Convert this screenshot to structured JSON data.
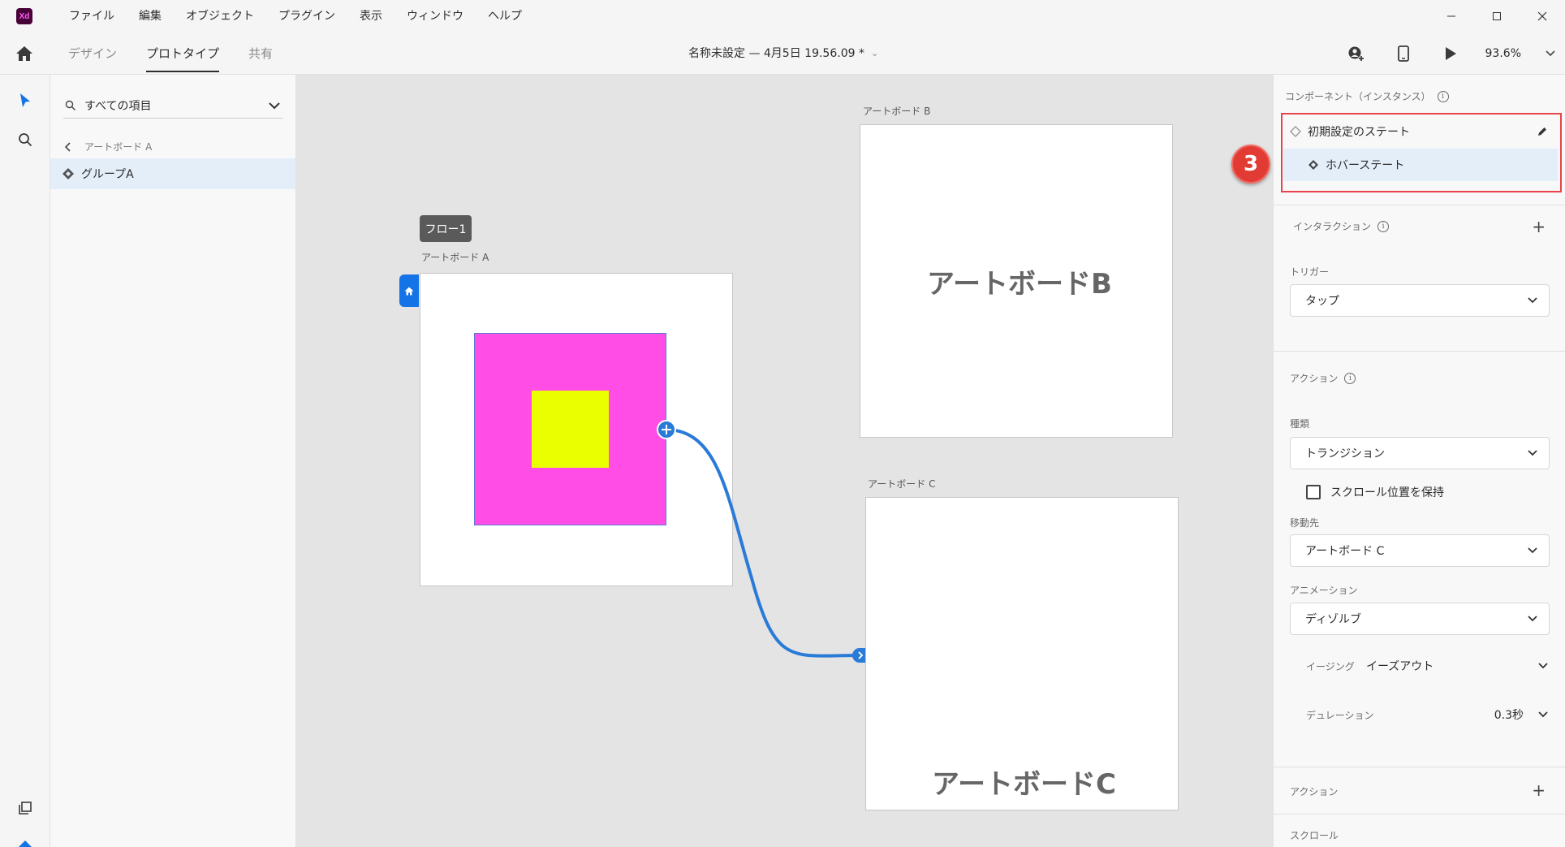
{
  "app": {
    "logo_text": "Xd"
  },
  "menu": [
    "ファイル",
    "編集",
    "オブジェクト",
    "プラグイン",
    "表示",
    "ウィンドウ",
    "ヘルプ"
  ],
  "toolbar": {
    "tabs": [
      "デザイン",
      "プロトタイプ",
      "共有"
    ],
    "active_tab": "プロトタイプ",
    "doc_title": "名称未設定 — 4月5日 19.56.09 *",
    "zoom": "93.6%"
  },
  "layers": {
    "search_placeholder": "すべての項目",
    "breadcrumb": "アートボード A",
    "selected_layer": "グループA"
  },
  "canvas": {
    "flow_badge": "フロー1",
    "artboard_a_label": "アートボード A",
    "artboard_b_label": "アートボード B",
    "artboard_c_label": "アートボード C",
    "artboard_b_text": "アートボードB",
    "artboard_c_text": "アートボードC",
    "colors": {
      "magenta": "#ff4de6",
      "yellow": "#eaff00",
      "wire": "#2a7bd8"
    }
  },
  "props": {
    "component_title": "コンポーネント（インスタンス）",
    "states": [
      "初期設定のステート",
      "ホバーステート"
    ],
    "step_badge": "3",
    "interaction_title": "インタラクション",
    "trigger_label": "トリガー",
    "trigger_value": "タップ",
    "action_title": "アクション",
    "type_label": "種類",
    "type_value": "トランジション",
    "keep_scroll": "スクロール位置を保持",
    "destination_label": "移動先",
    "destination_value": "アートボード C",
    "animation_label": "アニメーション",
    "animation_value": "ディゾルブ",
    "easing_label": "イージング",
    "easing_value": "イーズアウト",
    "duration_label": "デュレーション",
    "duration_value": "0.3秒",
    "action2_title": "アクション",
    "scroll_title": "スクロール"
  }
}
